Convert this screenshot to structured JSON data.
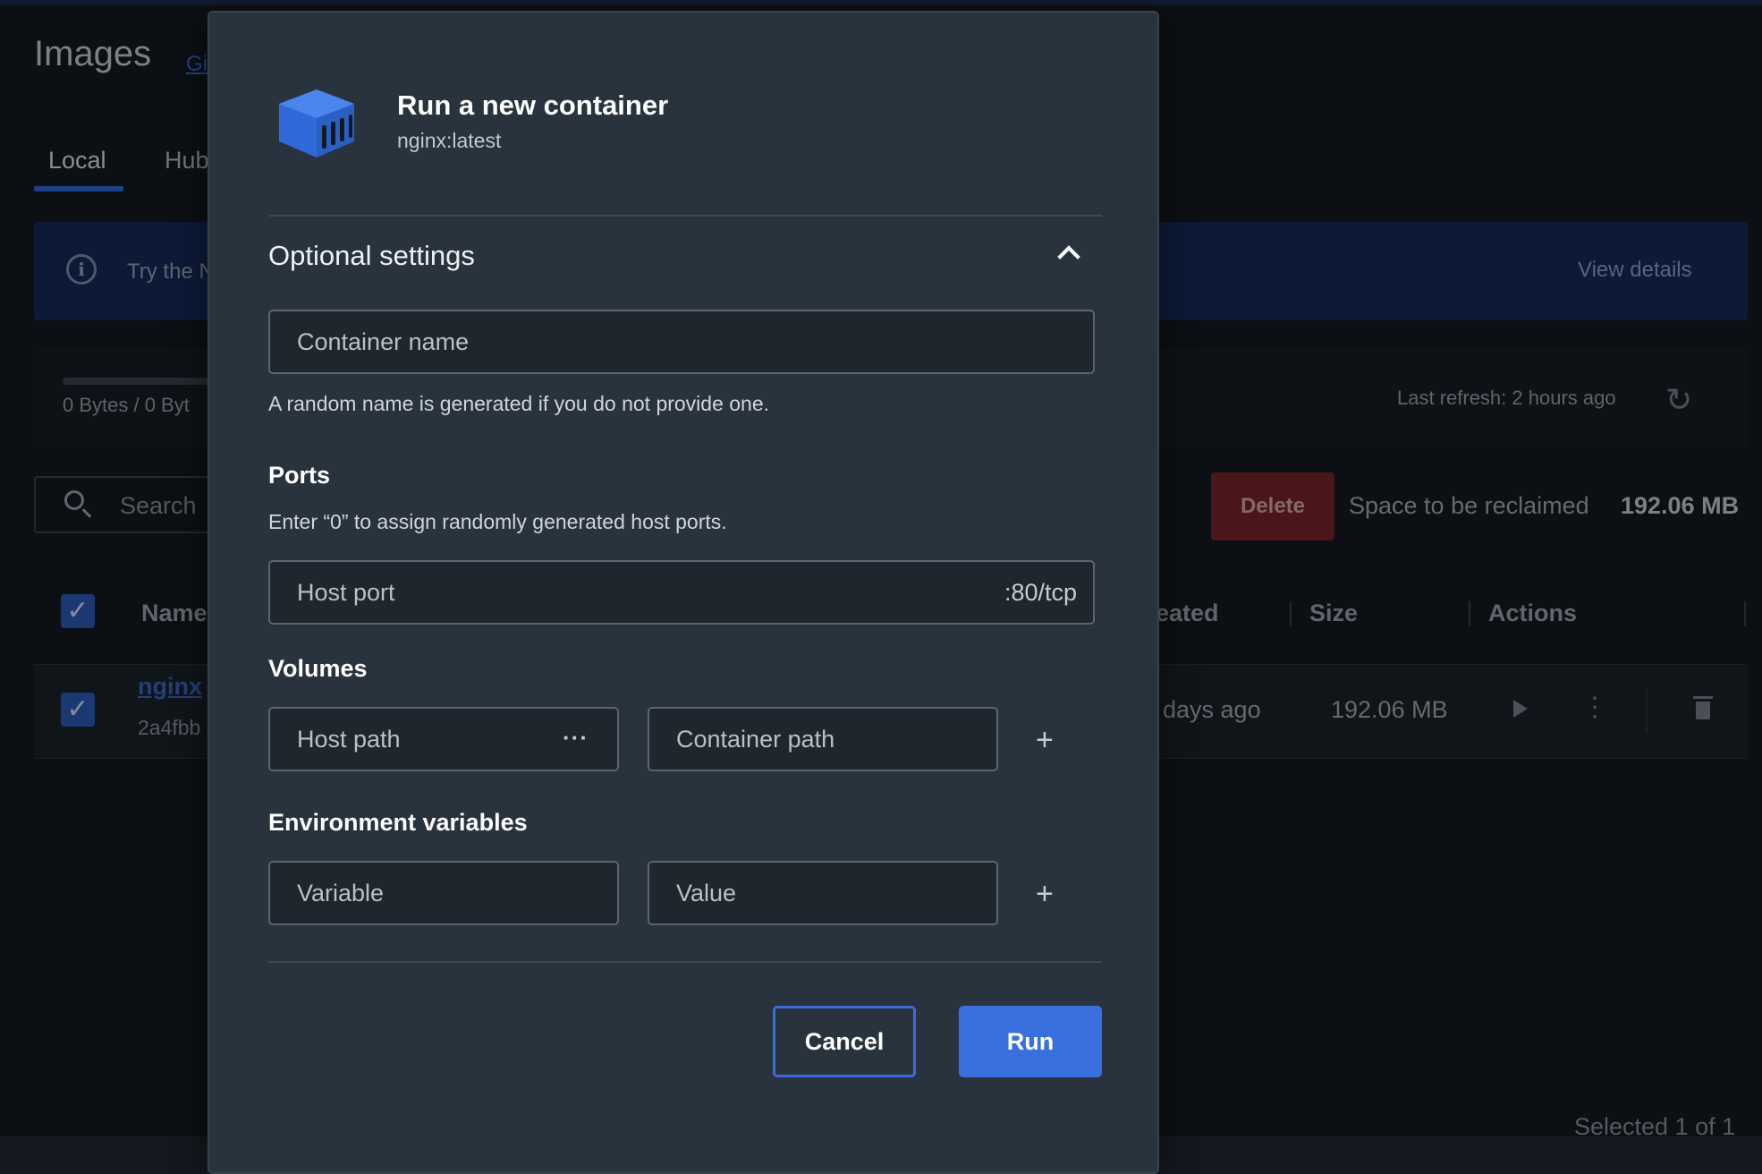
{
  "background": {
    "page_title": "Images",
    "page_link": "Gi",
    "tabs": [
      {
        "label": "Local"
      },
      {
        "label": "Hub"
      }
    ],
    "banner": {
      "text": "Try the N",
      "link": "View details"
    },
    "storage": {
      "text": "0 Bytes / 0 Byt"
    },
    "refresh": {
      "text": "Last refresh: 2 hours ago"
    },
    "search": {
      "placeholder": "Search"
    },
    "delete_label": "Delete",
    "reclaim": {
      "label": "Space to be reclaimed",
      "value": "192.06 MB"
    },
    "table": {
      "columns": [
        "Name",
        "eated",
        "Size",
        "Actions"
      ],
      "rows": [
        {
          "name": "nginx",
          "id": "2a4fbb",
          "created": "days ago",
          "size": "192.06 MB"
        }
      ]
    },
    "footer": {
      "selected": "Selected 1 of 1"
    }
  },
  "modal": {
    "title": "Run a new container",
    "subtitle": "nginx:latest",
    "section_title": "Optional settings",
    "container_name": {
      "placeholder": "Container name",
      "helper": "A random name is generated if you do not provide one."
    },
    "ports": {
      "label": "Ports",
      "helper": "Enter “0” to assign randomly generated host ports.",
      "host_port_placeholder": "Host port",
      "container_port": ":80/tcp"
    },
    "volumes": {
      "label": "Volumes",
      "host_path_placeholder": "Host path",
      "container_path_placeholder": "Container path"
    },
    "env": {
      "label": "Environment variables",
      "variable_placeholder": "Variable",
      "value_placeholder": "Value"
    },
    "cancel_label": "Cancel",
    "run_label": "Run"
  },
  "icons": {
    "more": "···",
    "plus": "+",
    "check": "✓",
    "refresh": "↻",
    "info": "i",
    "kebab": "⋮"
  },
  "colors": {
    "accent": "#3a6fde",
    "danger": "#7a2429",
    "modal_bg": "#29333d",
    "page_bg": "#14191f"
  }
}
